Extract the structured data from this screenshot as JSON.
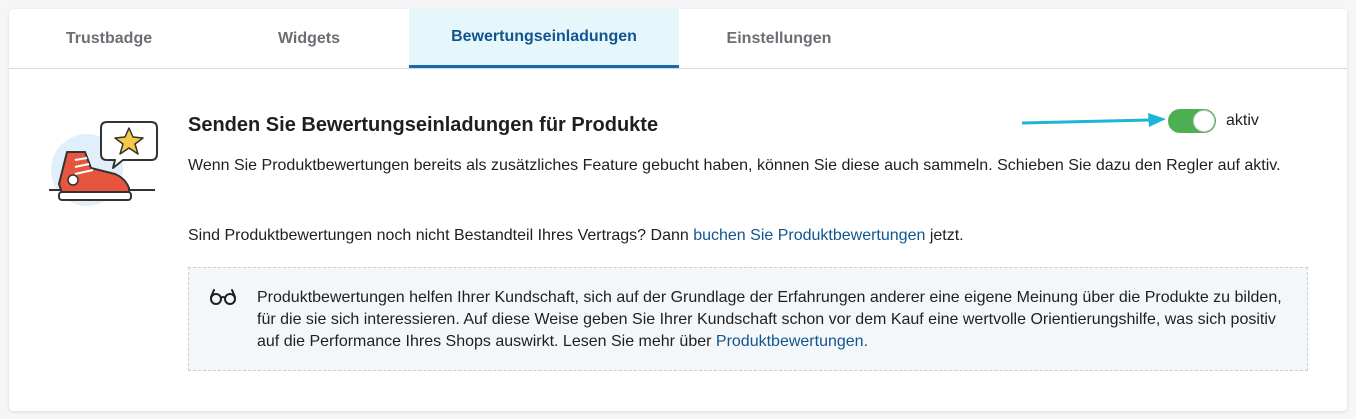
{
  "tabs": [
    {
      "label": "Trustbadge"
    },
    {
      "label": "Widgets"
    },
    {
      "label": "Bewertungseinladungen",
      "active": true
    },
    {
      "label": "Einstellungen"
    }
  ],
  "section": {
    "heading": "Senden Sie Bewertungseinladungen für Produkte",
    "toggle": {
      "state": "on",
      "label": "aktiv",
      "color": "#4caf50"
    },
    "paragraph1": "Wenn Sie Produktbewertungen bereits als zusätzliches Feature gebucht haben, können Sie diese auch sammeln. Schieben Sie dazu den Regler auf aktiv.",
    "paragraph2_before": "Sind Produktbewertungen noch nicht Bestandteil Ihres Vertrags? Dann ",
    "paragraph2_link": "buchen Sie Produktbewertungen",
    "paragraph2_after": " jetzt."
  },
  "infobox": {
    "icon": "glasses-icon",
    "text_before": "Produktbewertungen helfen Ihrer Kundschaft, sich auf der Grundlage der Erfahrungen anderer eine eigene Meinung über die Produkte zu bilden, für die sie sich interessieren. Auf diese Weise geben Sie Ihrer Kundschaft schon vor dem Kauf eine wertvolle Orientierungshilfe, was sich positiv auf die Performance Ihres Shops auswirkt. Lesen Sie mehr über ",
    "link": "Produktbewertungen."
  },
  "colors": {
    "accent": "#11558f",
    "active_tab_bg": "#e6f7fc",
    "arrow": "#1cb4d8",
    "sneaker": "#e8553f",
    "star": "#f7c948"
  }
}
